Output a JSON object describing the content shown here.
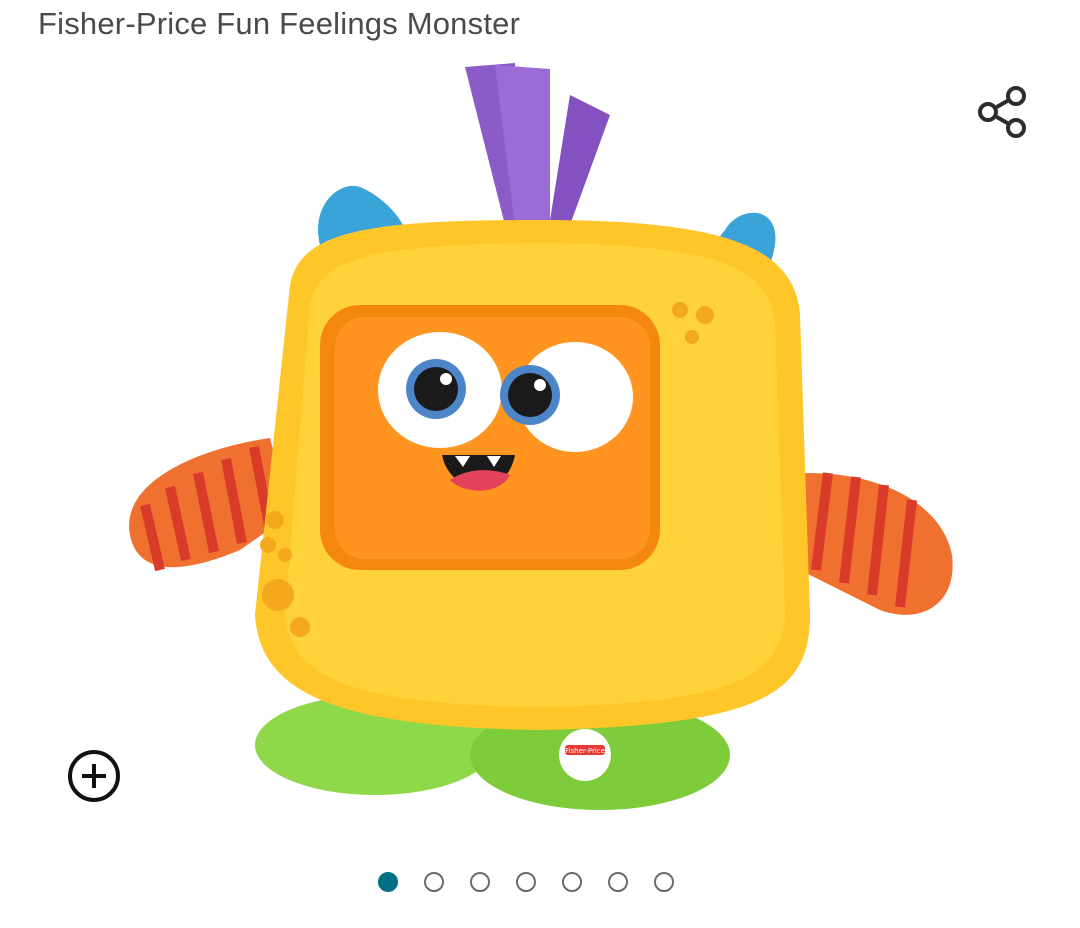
{
  "product": {
    "title": "Fisher-Price Fun Feelings Monster",
    "image_icon": "monster-toy-image",
    "brand_badge": "Fisher-Price"
  },
  "actions": {
    "share_icon": "share-icon",
    "zoom_icon": "zoom-plus-icon"
  },
  "gallery": {
    "total_images": 7,
    "selected_index": 0,
    "active_color": "#007185"
  }
}
